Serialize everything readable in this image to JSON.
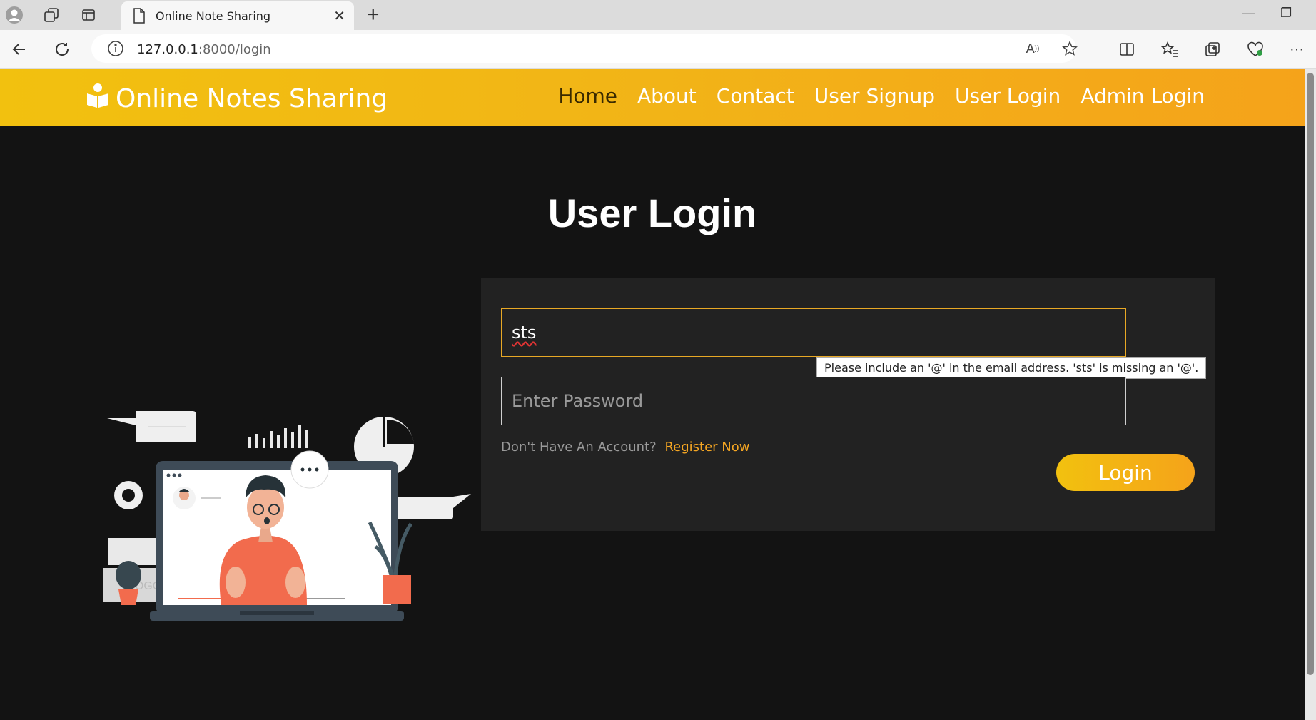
{
  "browser": {
    "tab_title": "Online Note Sharing",
    "url_host": "127.0.0.1",
    "url_rest": ":8000/login"
  },
  "site": {
    "brand": "Online Notes Sharing",
    "nav": [
      {
        "label": "Home",
        "active": true
      },
      {
        "label": "About"
      },
      {
        "label": "Contact"
      },
      {
        "label": "User Signup"
      },
      {
        "label": "User Login"
      },
      {
        "label": "Admin Login"
      }
    ],
    "accent": "#f5a623"
  },
  "login": {
    "title": "User Login",
    "email_value": "sts",
    "password_placeholder": "Enter Password",
    "validation_tooltip": "Please include an '@' in the email address. 'sts' is missing an '@'.",
    "register_question": "Don't Have An Account?",
    "register_link": "Register Now",
    "login_button": "Login"
  }
}
